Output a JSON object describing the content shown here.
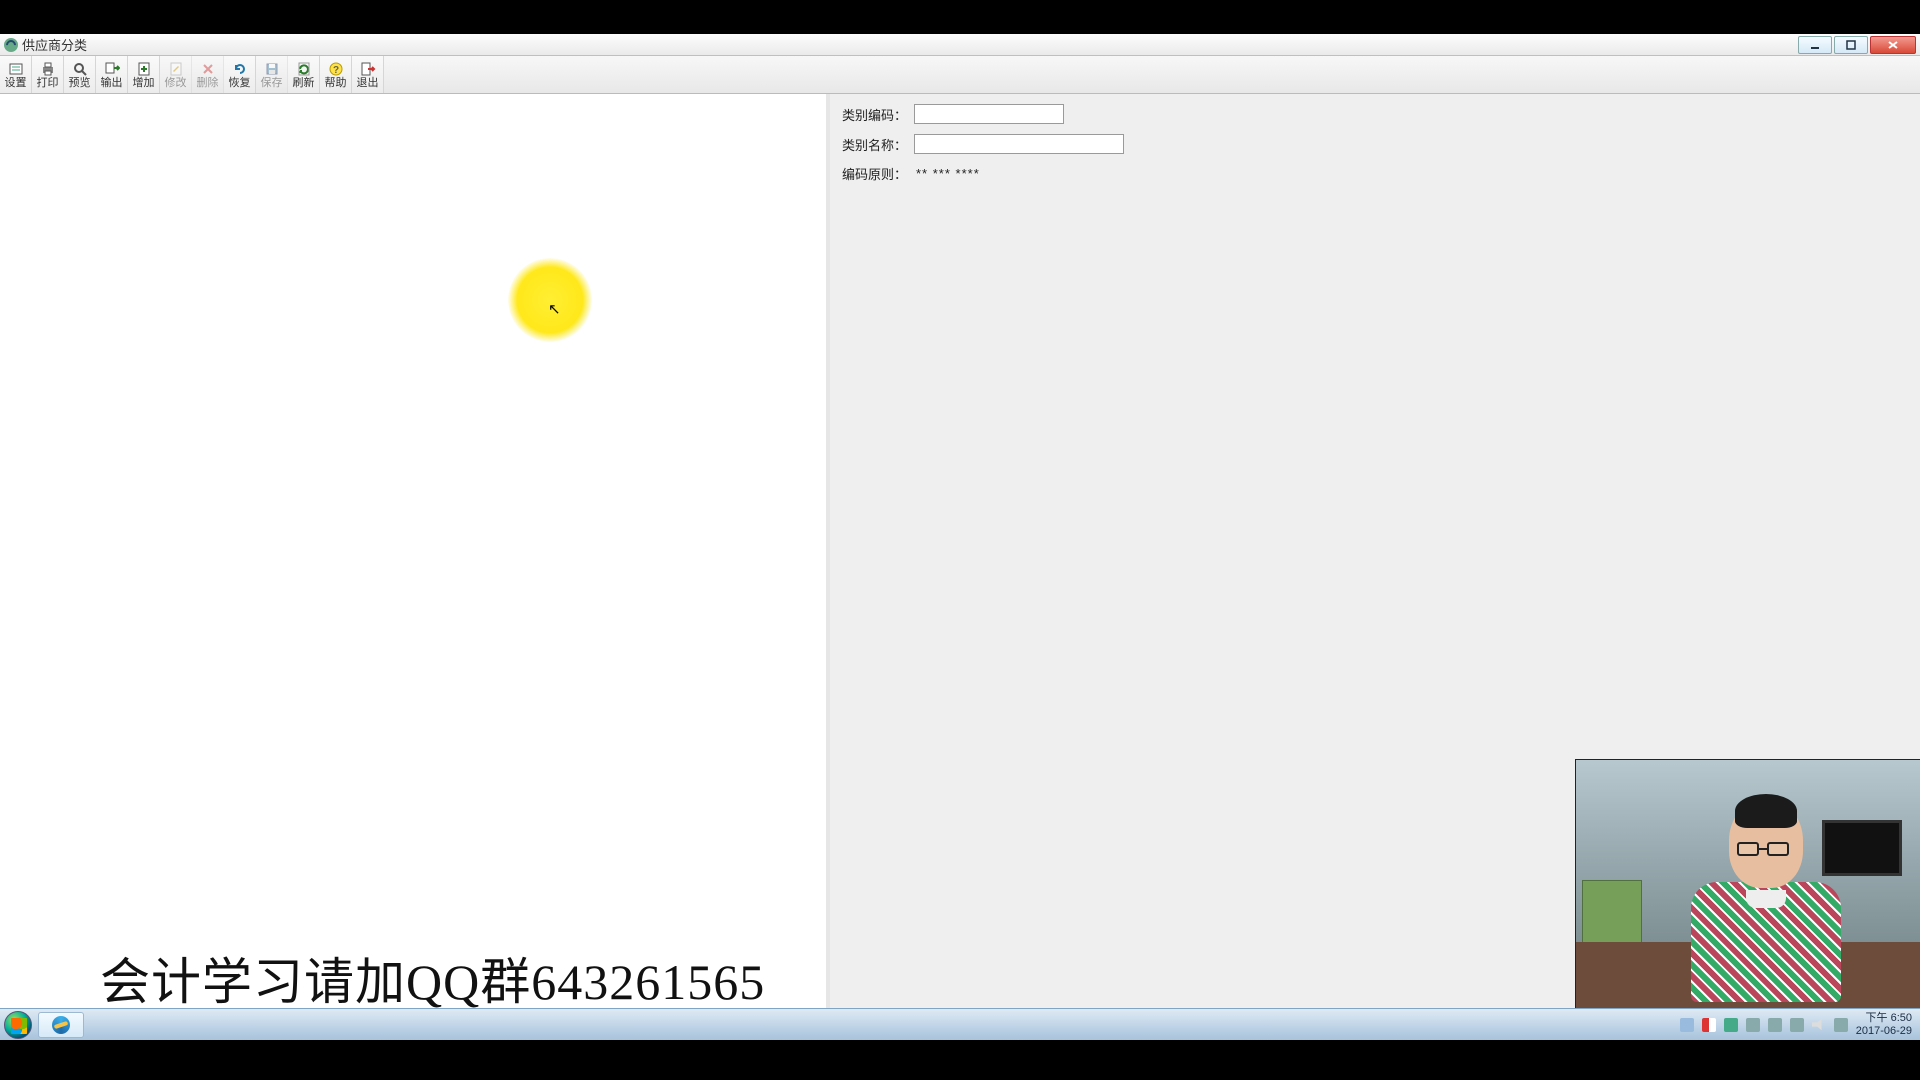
{
  "window": {
    "title": "供应商分类"
  },
  "toolbar": [
    {
      "key": "settings",
      "label": "设置",
      "enabled": true
    },
    {
      "key": "print",
      "label": "打印",
      "enabled": true
    },
    {
      "key": "preview",
      "label": "预览",
      "enabled": true
    },
    {
      "key": "output",
      "label": "输出",
      "enabled": true
    },
    {
      "key": "add",
      "label": "增加",
      "enabled": true
    },
    {
      "key": "modify",
      "label": "修改",
      "enabled": false
    },
    {
      "key": "delete",
      "label": "删除",
      "enabled": false
    },
    {
      "key": "restore",
      "label": "恢复",
      "enabled": true
    },
    {
      "key": "save",
      "label": "保存",
      "enabled": false
    },
    {
      "key": "refresh",
      "label": "刷新",
      "enabled": true
    },
    {
      "key": "help",
      "label": "帮助",
      "enabled": true
    },
    {
      "key": "exit",
      "label": "退出",
      "enabled": true
    }
  ],
  "form": {
    "code_label": "类别编码：",
    "code_value": "",
    "name_label": "类别名称：",
    "name_value": "",
    "rule_label": "编码原则：",
    "rule_value": "** *** ****"
  },
  "watermark": "会计学习请加QQ群643261565",
  "clock": {
    "time": "下午 6:50",
    "date": "2017-06-29"
  }
}
